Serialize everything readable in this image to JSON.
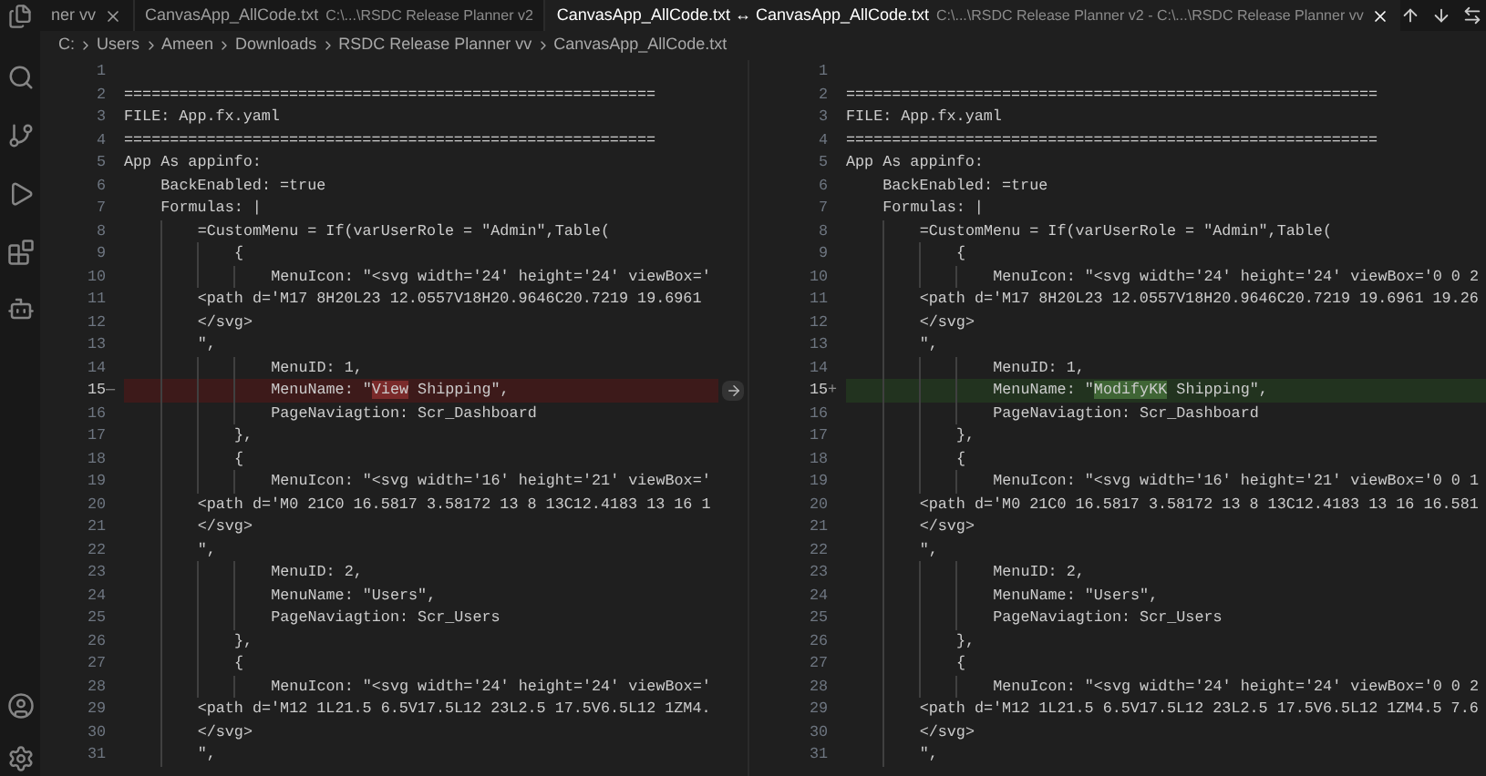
{
  "tabs": [
    {
      "label": "ner vv",
      "selected": false,
      "closable": true
    },
    {
      "label": "CanvasApp_AllCode.txt",
      "description": "C:\\...\\RSDC Release Planner v2",
      "selected": false,
      "closable": false
    },
    {
      "label": "CanvasApp_AllCode.txt ↔ CanvasApp_AllCode.txt",
      "description": "C:\\...\\RSDC Release Planner v2 - C:\\...\\RSDC Release Planner vv",
      "selected": true,
      "closable": true
    }
  ],
  "breadcrumb": [
    "C:",
    "Users",
    "Ameen",
    "Downloads",
    "RSDC Release Planner vv",
    "CanvasApp_AllCode.txt"
  ],
  "panes": [
    {
      "lines": [
        {
          "number": "1"
        },
        {
          "number": "2",
          "text": "=========================================================="
        },
        {
          "number": "3",
          "text": "FILE: App.fx.yaml"
        },
        {
          "number": "4",
          "text": "=========================================================="
        },
        {
          "number": "5",
          "text": "App As appinfo:"
        },
        {
          "number": "6",
          "text": "    BackEnabled: =true"
        },
        {
          "number": "7",
          "text": "    Formulas: |"
        },
        {
          "number": "8",
          "text": "        =CustomMenu = If(varUserRole = \"Admin\",Table("
        },
        {
          "number": "9",
          "text": "            {"
        },
        {
          "number": "10",
          "text": "                MenuIcon: \"<svg width='24' height='24' viewBox='"
        },
        {
          "number": "11",
          "text": "        <path d='M17 8H20L23 12.0557V18H20.9646C20.7219 19.6961"
        },
        {
          "number": "12",
          "text": "        </svg>"
        },
        {
          "number": "13",
          "text": "        \","
        },
        {
          "number": "14",
          "text": "                MenuID: 1,"
        },
        {
          "number": "15",
          "kind": "removed",
          "marker": "—",
          "segments": [
            {
              "text": "                MenuName: \"",
              "changed": false
            },
            {
              "text": "View",
              "changed": true
            },
            {
              "text": " Shipping\",",
              "changed": false
            }
          ]
        },
        {
          "number": "16",
          "text": "                PageNaviagtion: Scr_Dashboard"
        },
        {
          "number": "17",
          "text": "            },"
        },
        {
          "number": "18",
          "text": "            {"
        },
        {
          "number": "19",
          "text": "                MenuIcon: \"<svg width='16' height='21' viewBox='"
        },
        {
          "number": "20",
          "text": "        <path d='M0 21C0 16.5817 3.58172 13 8 13C12.4183 13 16 1"
        },
        {
          "number": "21",
          "text": "        </svg>"
        },
        {
          "number": "22",
          "text": "        \","
        },
        {
          "number": "23",
          "text": "                MenuID: 2,"
        },
        {
          "number": "24",
          "text": "                MenuName: \"Users\","
        },
        {
          "number": "25",
          "text": "                PageNaviagtion: Scr_Users"
        },
        {
          "number": "26",
          "text": "            },"
        },
        {
          "number": "27",
          "text": "            {"
        },
        {
          "number": "28",
          "text": "                MenuIcon: \"<svg width='24' height='24' viewBox='"
        },
        {
          "number": "29",
          "text": "        <path d='M12 1L21.5 6.5V17.5L12 23L2.5 17.5V6.5L12 1ZM4."
        },
        {
          "number": "30",
          "text": "        </svg>"
        },
        {
          "number": "31",
          "text": "        \","
        }
      ]
    },
    {
      "lines": [
        {
          "number": "1"
        },
        {
          "number": "2",
          "text": "=========================================================="
        },
        {
          "number": "3",
          "text": "FILE: App.fx.yaml"
        },
        {
          "number": "4",
          "text": "=========================================================="
        },
        {
          "number": "5",
          "text": "App As appinfo:"
        },
        {
          "number": "6",
          "text": "    BackEnabled: =true"
        },
        {
          "number": "7",
          "text": "    Formulas: |"
        },
        {
          "number": "8",
          "text": "        =CustomMenu = If(varUserRole = \"Admin\",Table("
        },
        {
          "number": "9",
          "text": "            {"
        },
        {
          "number": "10",
          "text": "                MenuIcon: \"<svg width='24' height='24' viewBox='0 0 2"
        },
        {
          "number": "11",
          "text": "        <path d='M17 8H20L23 12.0557V18H20.9646C20.7219 19.6961 19.26"
        },
        {
          "number": "12",
          "text": "        </svg>"
        },
        {
          "number": "13",
          "text": "        \","
        },
        {
          "number": "14",
          "text": "                MenuID: 1,"
        },
        {
          "number": "15",
          "kind": "added",
          "marker": "+",
          "segments": [
            {
              "text": "                MenuName: \"",
              "changed": false
            },
            {
              "text": "ModifyKK",
              "changed": true
            },
            {
              "text": " Shipping\",",
              "changed": false
            }
          ]
        },
        {
          "number": "16",
          "text": "                PageNaviagtion: Scr_Dashboard"
        },
        {
          "number": "17",
          "text": "            },"
        },
        {
          "number": "18",
          "text": "            {"
        },
        {
          "number": "19",
          "text": "                MenuIcon: \"<svg width='16' height='21' viewBox='0 0 1"
        },
        {
          "number": "20",
          "text": "        <path d='M0 21C0 16.5817 3.58172 13 8 13C12.4183 13 16 16.581"
        },
        {
          "number": "21",
          "text": "        </svg>"
        },
        {
          "number": "22",
          "text": "        \","
        },
        {
          "number": "23",
          "text": "                MenuID: 2,"
        },
        {
          "number": "24",
          "text": "                MenuName: \"Users\","
        },
        {
          "number": "25",
          "text": "                PageNaviagtion: Scr_Users"
        },
        {
          "number": "26",
          "text": "            },"
        },
        {
          "number": "27",
          "text": "            {"
        },
        {
          "number": "28",
          "text": "                MenuIcon: \"<svg width='24' height='24' viewBox='0 0 2"
        },
        {
          "number": "29",
          "text": "        <path d='M12 1L21.5 6.5V17.5L12 23L2.5 17.5V6.5L12 1ZM4.5 7.6"
        },
        {
          "number": "30",
          "text": "        </svg>"
        },
        {
          "number": "31",
          "text": "        \","
        }
      ]
    }
  ]
}
